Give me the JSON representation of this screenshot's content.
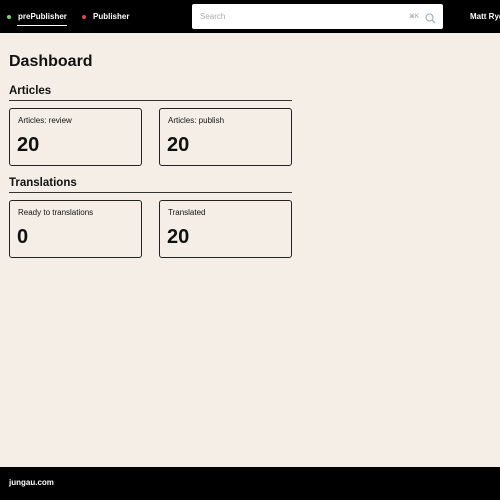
{
  "topbar": {
    "nav": [
      {
        "label": "prePublisher",
        "dot_color": "#7bd36b",
        "active": true
      },
      {
        "label": "Publisher",
        "dot_color": "#e0483e",
        "active": false
      }
    ],
    "search": {
      "placeholder": "Search",
      "shortcut": "⌘K",
      "icon": "search-icon"
    },
    "user": {
      "name": "Matt Ryd"
    }
  },
  "page": {
    "title": "Dashboard",
    "sections": [
      {
        "title": "Articles",
        "cards": [
          {
            "label": "Articles: review",
            "value": "20"
          },
          {
            "label": "Articles: publish",
            "value": "20"
          }
        ]
      },
      {
        "title": "Translations",
        "cards": [
          {
            "label": "Ready to translations",
            "value": "0"
          },
          {
            "label": "Translated",
            "value": "20"
          }
        ]
      }
    ]
  },
  "footer": {
    "text": "jungau.com"
  },
  "colors": {
    "background": "#f4eee6",
    "bars": "#000000",
    "text": "#111111"
  }
}
